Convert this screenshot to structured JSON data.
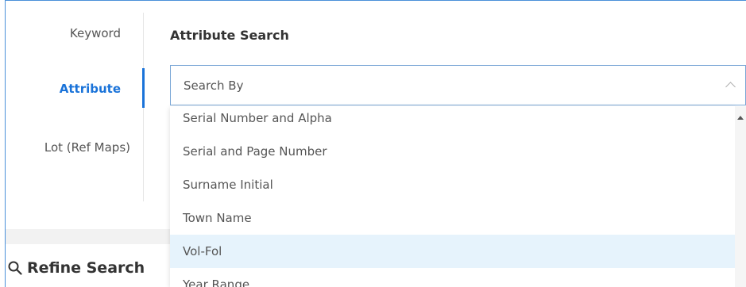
{
  "tabs": [
    {
      "label": "Keyword"
    },
    {
      "label": "Attribute",
      "active": true
    },
    {
      "label": "Lot (Ref Maps)"
    }
  ],
  "section_title": "Attribute Search",
  "select": {
    "placeholder": "Search By"
  },
  "options": [
    {
      "label": "Serial Number and Alpha"
    },
    {
      "label": "Serial and Page Number"
    },
    {
      "label": "Surname Initial"
    },
    {
      "label": "Town Name"
    },
    {
      "label": "Vol-Fol",
      "highlighted": true
    },
    {
      "label": "Year Range"
    }
  ],
  "refine": {
    "title": "Refine Search",
    "icon": "search-icon"
  },
  "colors": {
    "accent": "#1a73d9",
    "highlight": "#e6f3fc",
    "text": "#555555"
  }
}
